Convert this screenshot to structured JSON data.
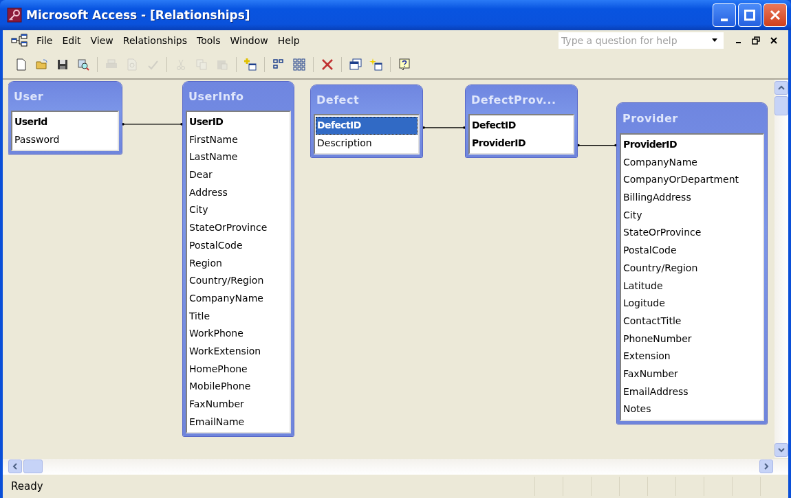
{
  "window": {
    "title": "Microsoft Access - [Relationships]"
  },
  "menu": [
    "File",
    "Edit",
    "View",
    "Relationships",
    "Tools",
    "Window",
    "Help"
  ],
  "help_box": {
    "placeholder": "Type a question for help"
  },
  "toolbar": [
    [
      {
        "kind": "new",
        "disabled": false
      },
      {
        "kind": "open",
        "disabled": false
      },
      {
        "kind": "save",
        "disabled": false
      },
      {
        "kind": "search",
        "disabled": false
      }
    ],
    [
      {
        "kind": "print",
        "disabled": true
      },
      {
        "kind": "preview",
        "disabled": true
      },
      {
        "kind": "spell",
        "disabled": true
      }
    ],
    [
      {
        "kind": "cut",
        "disabled": true
      },
      {
        "kind": "copy",
        "disabled": true
      },
      {
        "kind": "paste",
        "disabled": true
      }
    ],
    [
      {
        "kind": "addtable",
        "disabled": false
      }
    ],
    [
      {
        "kind": "direct",
        "disabled": false
      },
      {
        "kind": "all",
        "disabled": false
      }
    ],
    [
      {
        "kind": "delete",
        "disabled": false
      }
    ],
    [
      {
        "kind": "window",
        "disabled": false
      },
      {
        "kind": "newobject",
        "disabled": false
      }
    ],
    [
      {
        "kind": "help",
        "disabled": false
      }
    ]
  ],
  "tables": [
    {
      "title": "User",
      "fields": [
        {
          "name": "UserId",
          "kind": "key",
          "selected": false
        },
        {
          "name": "Password",
          "kind": "plain",
          "selected": false
        }
      ]
    },
    {
      "title": "UserInfo",
      "fields": [
        {
          "name": "UserID",
          "kind": "key",
          "selected": false
        },
        {
          "name": "FirstName",
          "kind": "plain",
          "selected": false
        },
        {
          "name": "LastName",
          "kind": "plain",
          "selected": false
        },
        {
          "name": "Dear",
          "kind": "plain",
          "selected": false
        },
        {
          "name": "Address",
          "kind": "plain",
          "selected": false
        },
        {
          "name": "City",
          "kind": "plain",
          "selected": false
        },
        {
          "name": "StateOrProvince",
          "kind": "plain",
          "selected": false
        },
        {
          "name": "PostalCode",
          "kind": "plain",
          "selected": false
        },
        {
          "name": "Region",
          "kind": "plain",
          "selected": false
        },
        {
          "name": "Country/Region",
          "kind": "plain",
          "selected": false
        },
        {
          "name": "CompanyName",
          "kind": "plain",
          "selected": false
        },
        {
          "name": "Title",
          "kind": "plain",
          "selected": false
        },
        {
          "name": "WorkPhone",
          "kind": "plain",
          "selected": false
        },
        {
          "name": "WorkExtension",
          "kind": "plain",
          "selected": false
        },
        {
          "name": "HomePhone",
          "kind": "plain",
          "selected": false
        },
        {
          "name": "MobilePhone",
          "kind": "plain",
          "selected": false
        },
        {
          "name": "FaxNumber",
          "kind": "plain",
          "selected": false
        },
        {
          "name": "EmailName",
          "kind": "plain",
          "selected": false
        }
      ]
    },
    {
      "title": "Defect",
      "fields": [
        {
          "name": "DefectID",
          "kind": "key",
          "selected": true
        },
        {
          "name": "Description",
          "kind": "plain",
          "selected": false
        }
      ]
    },
    {
      "title": "DefectProv...",
      "fields": [
        {
          "name": "DefectID",
          "kind": "key",
          "selected": false
        },
        {
          "name": "ProviderID",
          "kind": "key",
          "selected": false
        }
      ]
    },
    {
      "title": "Provider",
      "fields": [
        {
          "name": "ProviderID",
          "kind": "key",
          "selected": false
        },
        {
          "name": "CompanyName",
          "kind": "plain",
          "selected": false
        },
        {
          "name": "CompanyOrDepartment",
          "kind": "plain",
          "selected": false
        },
        {
          "name": "BillingAddress",
          "kind": "plain",
          "selected": false
        },
        {
          "name": "City",
          "kind": "plain",
          "selected": false
        },
        {
          "name": "StateOrProvince",
          "kind": "plain",
          "selected": false
        },
        {
          "name": "PostalCode",
          "kind": "plain",
          "selected": false
        },
        {
          "name": "Country/Region",
          "kind": "plain",
          "selected": false
        },
        {
          "name": "Latitude",
          "kind": "plain",
          "selected": false
        },
        {
          "name": "Logitude",
          "kind": "plain",
          "selected": false
        },
        {
          "name": "ContactTitle",
          "kind": "plain",
          "selected": false
        },
        {
          "name": "PhoneNumber",
          "kind": "plain",
          "selected": false
        },
        {
          "name": "Extension",
          "kind": "plain",
          "selected": false
        },
        {
          "name": "FaxNumber",
          "kind": "plain",
          "selected": false
        },
        {
          "name": "EmailAddress",
          "kind": "plain",
          "selected": false
        },
        {
          "name": "Notes",
          "kind": "plain",
          "selected": false
        }
      ]
    }
  ],
  "status_bar": {
    "text": "Ready"
  }
}
